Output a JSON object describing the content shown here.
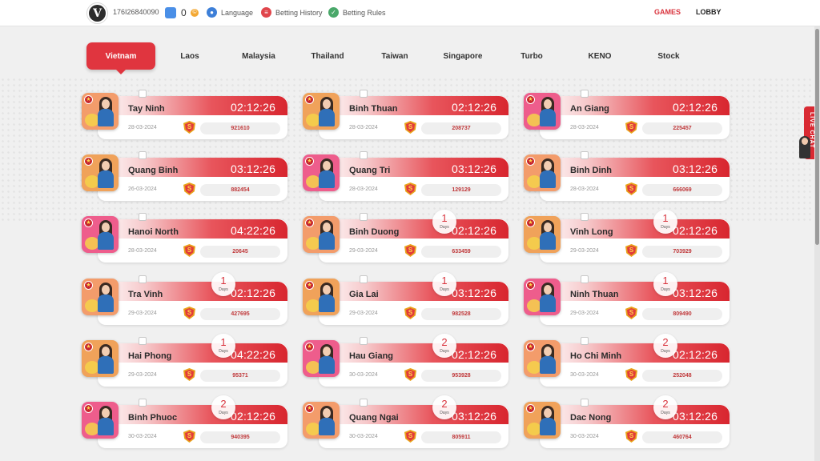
{
  "header": {
    "logo_letter": "V",
    "user_id": "176I26840090",
    "balance": "0",
    "coin_symbol": "©",
    "language_label": "Language",
    "betting_history_label": "Betting History",
    "betting_rules_label": "Betting Rules",
    "games_label": "GAMES",
    "lobby_label": "LOBBY"
  },
  "tabs": [
    "Vietnam",
    "Laos",
    "Malaysia",
    "Thailand",
    "Taiwan",
    "Singapore",
    "Turbo",
    "KENO",
    "Stock"
  ],
  "active_tab": "Vietnam",
  "days_label": "Days",
  "s_letter": "S",
  "cards": [
    {
      "name": "Tay Ninh",
      "time": "02:12:26",
      "date": "28-03-2024",
      "result": "921610",
      "days": null
    },
    {
      "name": "Binh Thuan",
      "time": "02:12:26",
      "date": "28-03-2024",
      "result": "208737",
      "days": null
    },
    {
      "name": "An Giang",
      "time": "02:12:26",
      "date": "28-03-2024",
      "result": "225457",
      "days": null
    },
    {
      "name": "Quang Binh",
      "time": "03:12:26",
      "date": "26-03-2024",
      "result": "882454",
      "days": null
    },
    {
      "name": "Quang Tri",
      "time": "03:12:26",
      "date": "28-03-2024",
      "result": "129129",
      "days": null
    },
    {
      "name": "Binh Dinh",
      "time": "03:12:26",
      "date": "28-03-2024",
      "result": "666069",
      "days": null
    },
    {
      "name": "Hanoi North",
      "time": "04:22:26",
      "date": "28-03-2024",
      "result": "20645",
      "days": null
    },
    {
      "name": "Binh Duong",
      "time": "02:12:26",
      "date": "29-03-2024",
      "result": "633459",
      "days": "1"
    },
    {
      "name": "Vinh Long",
      "time": "02:12:26",
      "date": "29-03-2024",
      "result": "703929",
      "days": "1"
    },
    {
      "name": "Tra Vinh",
      "time": "02:12:26",
      "date": "29-03-2024",
      "result": "427695",
      "days": "1"
    },
    {
      "name": "Gia Lai",
      "time": "03:12:26",
      "date": "29-03-2024",
      "result": "982528",
      "days": "1"
    },
    {
      "name": "Ninh Thuan",
      "time": "03:12:26",
      "date": "29-03-2024",
      "result": "809490",
      "days": "1"
    },
    {
      "name": "Hai Phong",
      "time": "04:22:26",
      "date": "29-03-2024",
      "result": "95371",
      "days": "1"
    },
    {
      "name": "Hau Giang",
      "time": "02:12:26",
      "date": "30-03-2024",
      "result": "953928",
      "days": "2"
    },
    {
      "name": "Ho Chi Minh",
      "time": "02:12:26",
      "date": "30-03-2024",
      "result": "252048",
      "days": "2"
    },
    {
      "name": "Binh Phuoc",
      "time": "02:12:26",
      "date": "30-03-2024",
      "result": "940395",
      "days": "2"
    },
    {
      "name": "Quang Ngai",
      "time": "03:12:26",
      "date": "30-03-2024",
      "result": "805911",
      "days": "2"
    },
    {
      "name": "Dac Nong",
      "time": "03:12:26",
      "date": "30-03-2024",
      "result": "460764",
      "days": "2"
    }
  ],
  "live_chat_label": "LIVE CHAT",
  "colors": {
    "accent": "#e0353f",
    "result_text": "#c0393b",
    "shield": "#e8a21a"
  }
}
